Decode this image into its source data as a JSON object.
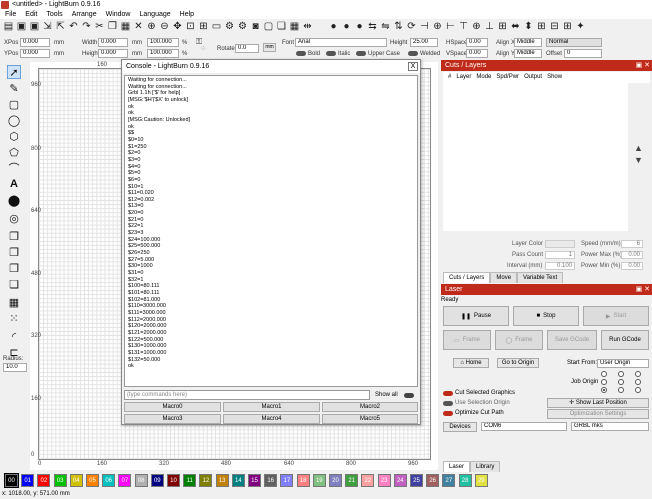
{
  "window": {
    "title": "<untitled> - LightBurn 0.9.16"
  },
  "menu": [
    "File",
    "Edit",
    "Tools",
    "Arrange",
    "Window",
    "Language",
    "Help"
  ],
  "props": {
    "xpos_label": "XPos",
    "xpos_value": "0.000",
    "ypos_label": "YPos",
    "ypos_value": "0.000",
    "unit": "mm",
    "width_label": "Width",
    "width_value": "0.000",
    "height_label": "Height",
    "height_value": "0.000",
    "scale_w": "100.000",
    "scale_h": "100.000",
    "pct": "%",
    "rotate_label": "Rotate",
    "rotate_value": "0.0",
    "mm_button": "mm",
    "font_label": "Font",
    "font_value": "Arial",
    "height2_label": "Height",
    "height2_value": "25.00",
    "hspace_label": "HSpace",
    "hspace_value": "0.00",
    "vspace_label": "VSpace",
    "vspace_value": "0.00",
    "alignx_label": "Align X",
    "alignx_value": "Middle",
    "aligny_label": "Align Y",
    "aligny_value": "Middle",
    "normal_value": "Normal",
    "offset_label": "Offset",
    "offset_value": "0",
    "bold": "Bold",
    "italic": "Italic",
    "upper": "Upper Case",
    "welded": "Welded"
  },
  "rulers": {
    "top": [
      "160",
      "320",
      "480",
      "640",
      "800",
      "960"
    ],
    "bottom": [
      "0",
      "160",
      "320",
      "480",
      "640",
      "800",
      "960"
    ],
    "left": [
      "960",
      "800",
      "640",
      "480",
      "320",
      "160",
      "0"
    ]
  },
  "radius": {
    "label": "Radius:",
    "value": "10.0"
  },
  "console": {
    "title": "Console - LightBurn 0.9.16",
    "close": "X",
    "lines": [
      "Waiting for connection...",
      "Waiting for connection...",
      "Grbl 1.1h ['$' for help]",
      "[MSG:'$H'|'$X' to unlock]",
      "ok",
      "ok",
      "[MSG:Caution: Unlocked]",
      "ok",
      "$$",
      "$0=10",
      "$1=250",
      "$2=0",
      "$3=0",
      "$4=0",
      "$5=0",
      "$6=0",
      "$10=1",
      "$11=0.020",
      "$12=0.002",
      "$13=0",
      "$20=0",
      "$21=0",
      "$22=1",
      "$23=3",
      "$24=100.000",
      "$25=500.000",
      "$26=250",
      "$27=5.000",
      "$30=1000",
      "$31=0",
      "$32=1",
      "$100=80.111",
      "$101=80.111",
      "$102=81.000",
      "$110=3000.000",
      "$111=3000.000",
      "$112=2000.000",
      "$120=2000.000",
      "$121=2000.000",
      "$122=500.000",
      "$130=1000.000",
      "$131=1000.000",
      "$132=50.000",
      "ok"
    ],
    "placeholder": "(type commands here)",
    "show_all": "Show all",
    "macros": [
      "Macro0",
      "Macro1",
      "Macro2",
      "Macro3",
      "Macro4",
      "Macro5"
    ]
  },
  "cuts": {
    "title": "Cuts / Layers",
    "columns": [
      "#",
      "Layer",
      "Mode",
      "Spd/Pwr",
      "Output",
      "Show"
    ],
    "layer_color_label": "Layer Color",
    "speed_label": "Speed (mm/m)",
    "speed_value": "6",
    "pass_count_label": "Pass Count",
    "pass_count_value": "1",
    "power_max_label": "Power Max (%)",
    "power_max_value": "0.00",
    "interval_label": "Interval (mm)",
    "interval_value": "0.100",
    "power_min_label": "Power Min (%)",
    "power_min_value": "0.00",
    "tabs": [
      "Cuts / Layers",
      "Move",
      "Variable Text"
    ]
  },
  "laser": {
    "title": "Laser",
    "status": "Ready",
    "pause": "Pause",
    "stop": "Stop",
    "start": "Start",
    "frame1": "Frame",
    "frame2": "Frame",
    "save_gcode": "Save GCode",
    "run_gcode": "Run GCode",
    "home": "Home",
    "go_to_origin": "Go to Origin",
    "start_from_label": "Start From:",
    "start_from_value": "User Origin",
    "job_origin_label": "Job Origin",
    "cut_selected": "Cut Selected Graphics",
    "use_selection": "Use Selection Origin",
    "optimize_cut": "Optimize Cut Path",
    "show_last_position": "Show Last Position",
    "optimization_settings": "Optimization Settings",
    "devices": "Devices",
    "port": "COM6",
    "device": "GRBL mks",
    "tabs": [
      "Laser",
      "Library"
    ]
  },
  "palette": [
    {
      "label": "00",
      "color": "#000000"
    },
    {
      "label": "01",
      "color": "#0000ff"
    },
    {
      "label": "02",
      "color": "#ff0000"
    },
    {
      "label": "03",
      "color": "#00c000"
    },
    {
      "label": "04",
      "color": "#d0c000"
    },
    {
      "label": "05",
      "color": "#ff8000"
    },
    {
      "label": "06",
      "color": "#00c0c0"
    },
    {
      "label": "07",
      "color": "#ff00ff"
    },
    {
      "label": "08",
      "color": "#b0b0b0"
    },
    {
      "label": "09",
      "color": "#000080"
    },
    {
      "label": "10",
      "color": "#800000"
    },
    {
      "label": "11",
      "color": "#008000"
    },
    {
      "label": "12",
      "color": "#808000"
    },
    {
      "label": "13",
      "color": "#c08000"
    },
    {
      "label": "14",
      "color": "#008080"
    },
    {
      "label": "15",
      "color": "#800080"
    },
    {
      "label": "16",
      "color": "#606060"
    },
    {
      "label": "17",
      "color": "#8080ff"
    },
    {
      "label": "18",
      "color": "#ff8080"
    },
    {
      "label": "19",
      "color": "#80c080"
    },
    {
      "label": "20",
      "color": "#8080c0"
    },
    {
      "label": "21",
      "color": "#40a040"
    },
    {
      "label": "22",
      "color": "#ffa0a0"
    },
    {
      "label": "23",
      "color": "#ff80c0"
    },
    {
      "label": "24",
      "color": "#c060c0"
    },
    {
      "label": "25",
      "color": "#4040a0"
    },
    {
      "label": "26",
      "color": "#a06060"
    },
    {
      "label": "27",
      "color": "#4080a0"
    },
    {
      "label": "28",
      "color": "#20c0a0"
    },
    {
      "label": "29",
      "color": "#e0e040"
    }
  ],
  "status": "x: 1018.00, y: 571.00 mm"
}
